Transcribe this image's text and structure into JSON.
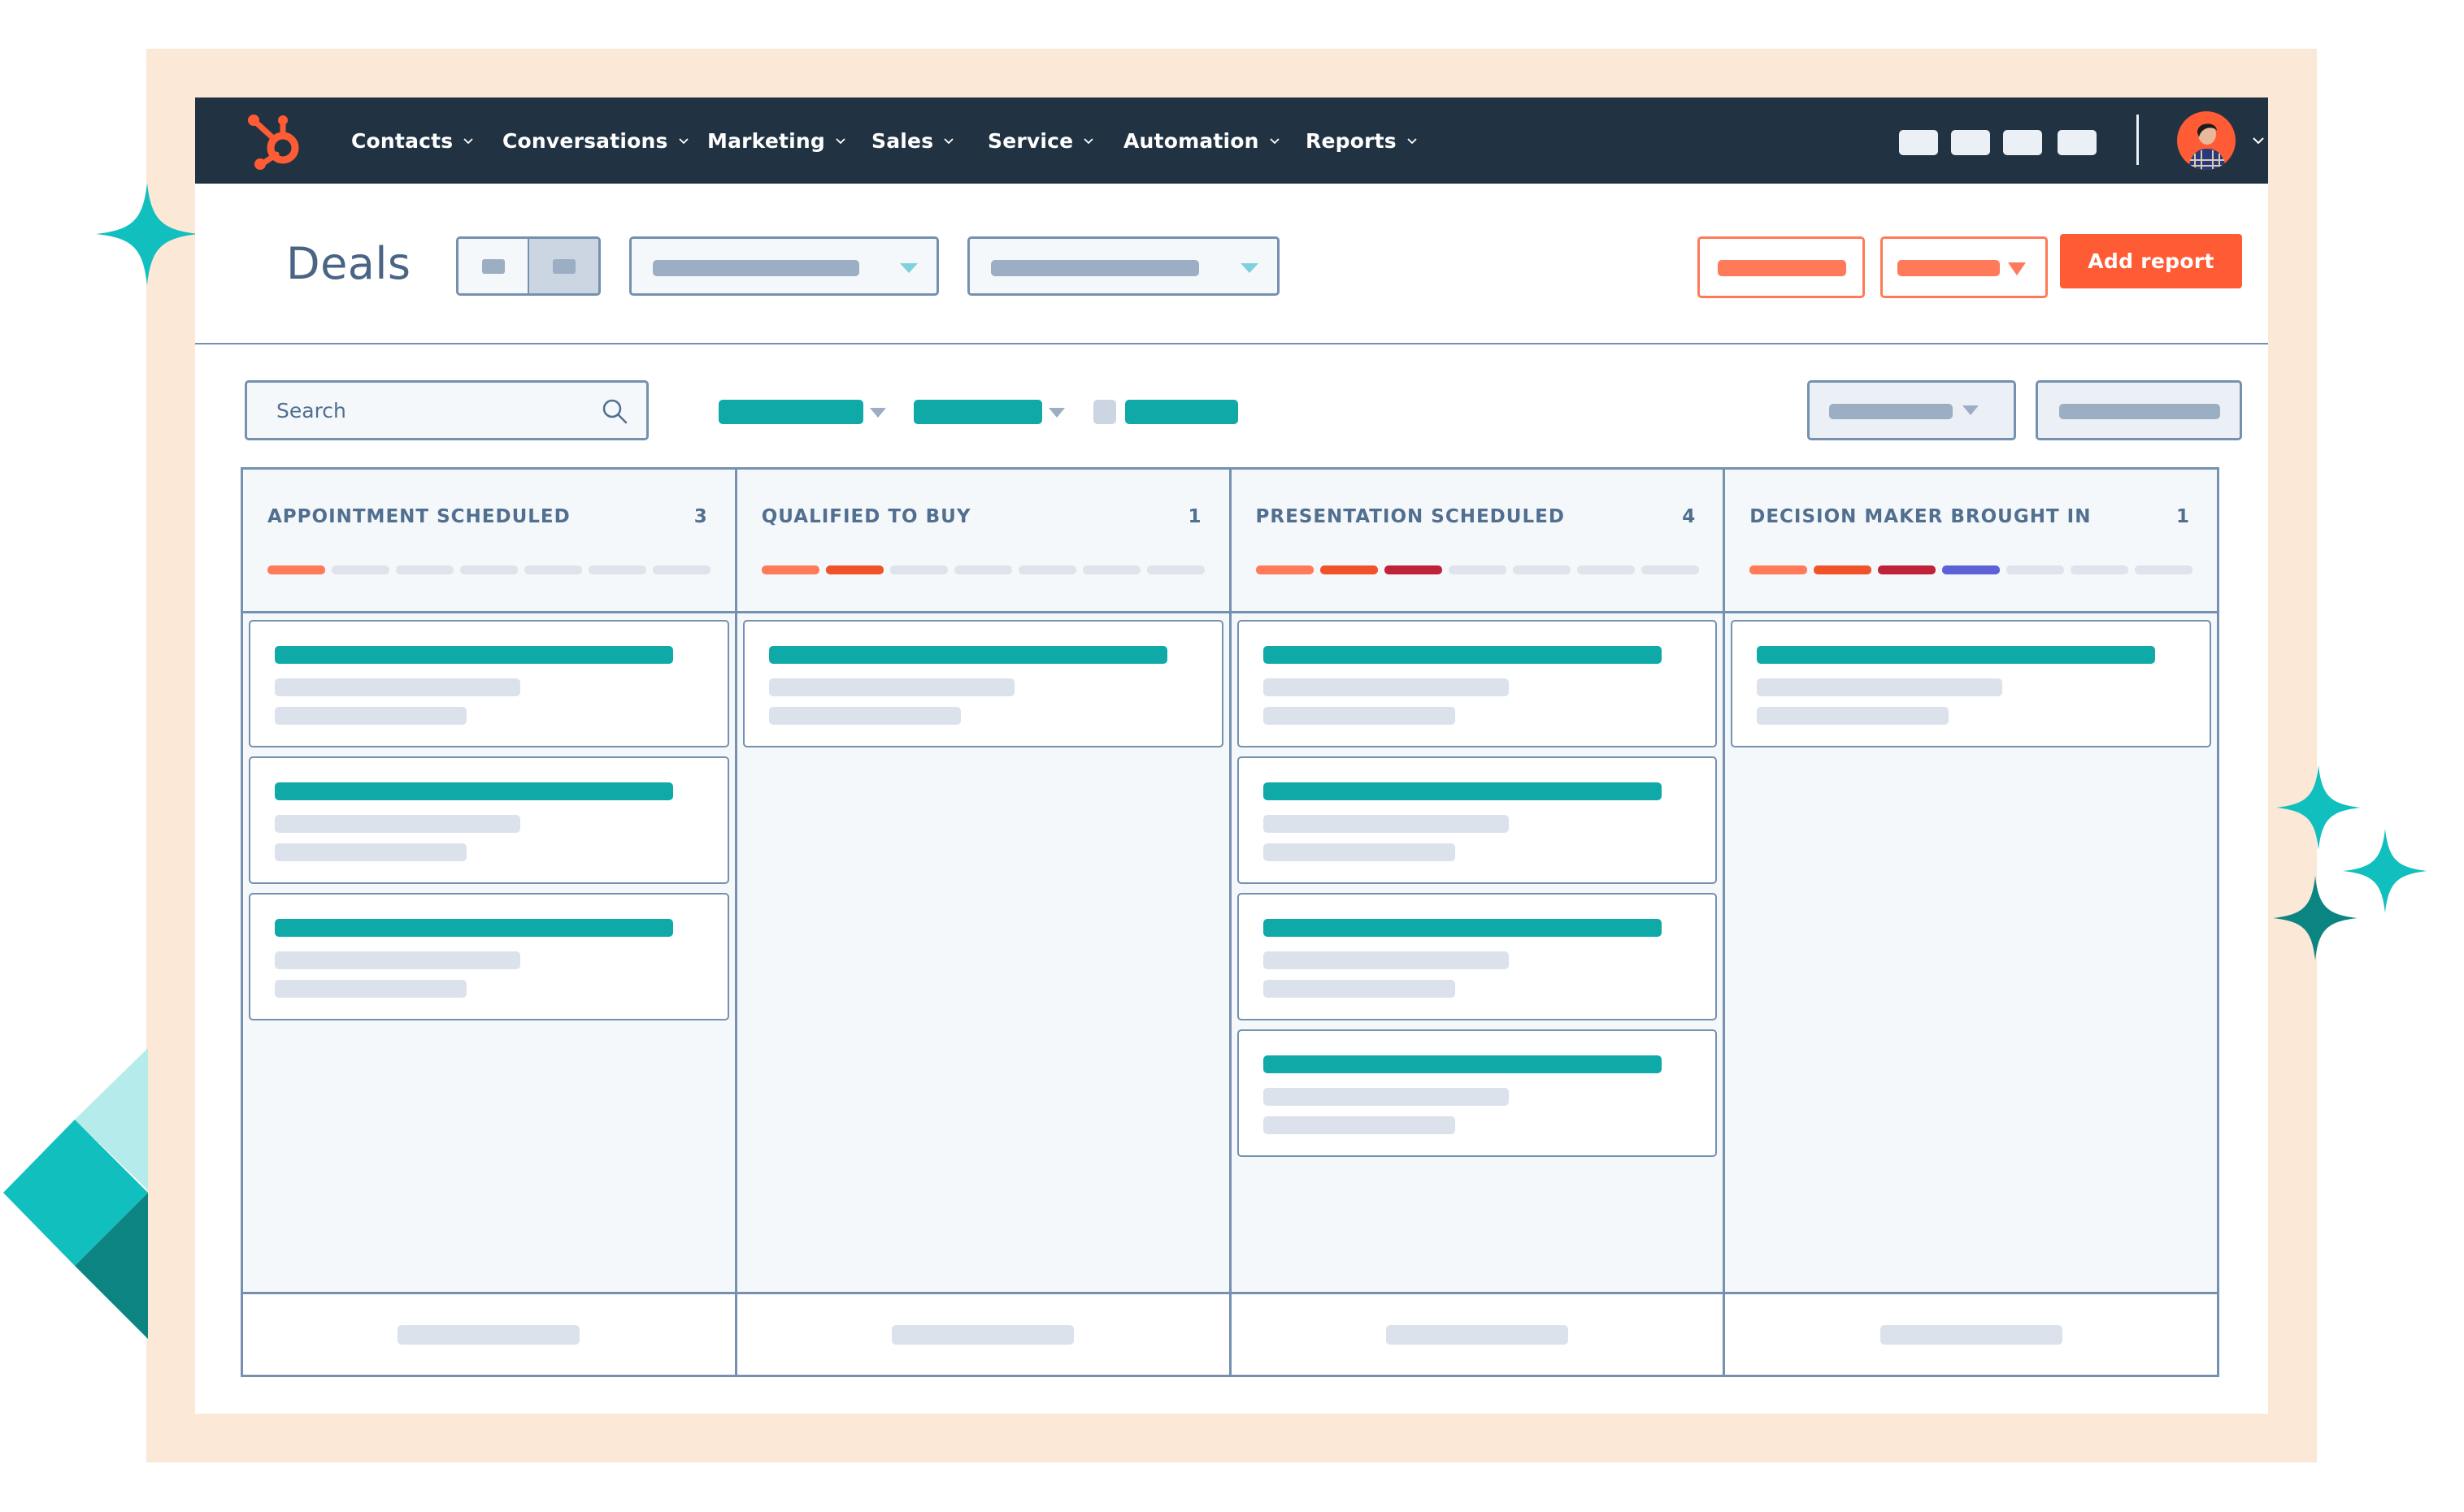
{
  "colors": {
    "frame_bg": "#fbe8d6",
    "navbar_bg": "#213343",
    "brand_orange": "#ff5c35",
    "accent_orange_light": "#ff7a59",
    "teal": "#0fa9a7",
    "sparkle_teal": "#12bfbf",
    "sparkle_dark_teal": "#0c8582",
    "sparkle_light_teal": "#b5ebea",
    "border": "#7591af",
    "text_slate": "#516f90",
    "stage_colors": [
      "#ff7a59",
      "#f0532a",
      "#c0223a",
      "#5c62d6"
    ],
    "stage_empty": "#dfe3eb"
  },
  "navbar": {
    "logo": "hubspot-sprocket-icon",
    "items": [
      {
        "label": "Contacts"
      },
      {
        "label": "Conversations"
      },
      {
        "label": "Marketing"
      },
      {
        "label": "Sales"
      },
      {
        "label": "Service"
      },
      {
        "label": "Automation"
      },
      {
        "label": "Reports"
      }
    ],
    "utility_icons": [
      "placeholder-icon",
      "placeholder-icon",
      "placeholder-icon",
      "placeholder-icon"
    ],
    "avatar": "user-avatar"
  },
  "header": {
    "title": "Deals",
    "view_toggle": [
      "board-view",
      "list-view"
    ],
    "add_report_label": "Add report"
  },
  "filters": {
    "search_placeholder": "Search"
  },
  "board": {
    "columns": [
      {
        "title": "APPOINTMENT SCHEDULED",
        "count": "3",
        "stage_filled": 1,
        "cards": 3
      },
      {
        "title": "QUALIFIED TO BUY",
        "count": "1",
        "stage_filled": 2,
        "cards": 1
      },
      {
        "title": "PRESENTATION SCHEDULED",
        "count": "4",
        "stage_filled": 3,
        "cards": 4
      },
      {
        "title": "DECISION MAKER BROUGHT IN",
        "count": "1",
        "stage_filled": 4,
        "cards": 1
      }
    ],
    "stage_segments_total": 7
  }
}
